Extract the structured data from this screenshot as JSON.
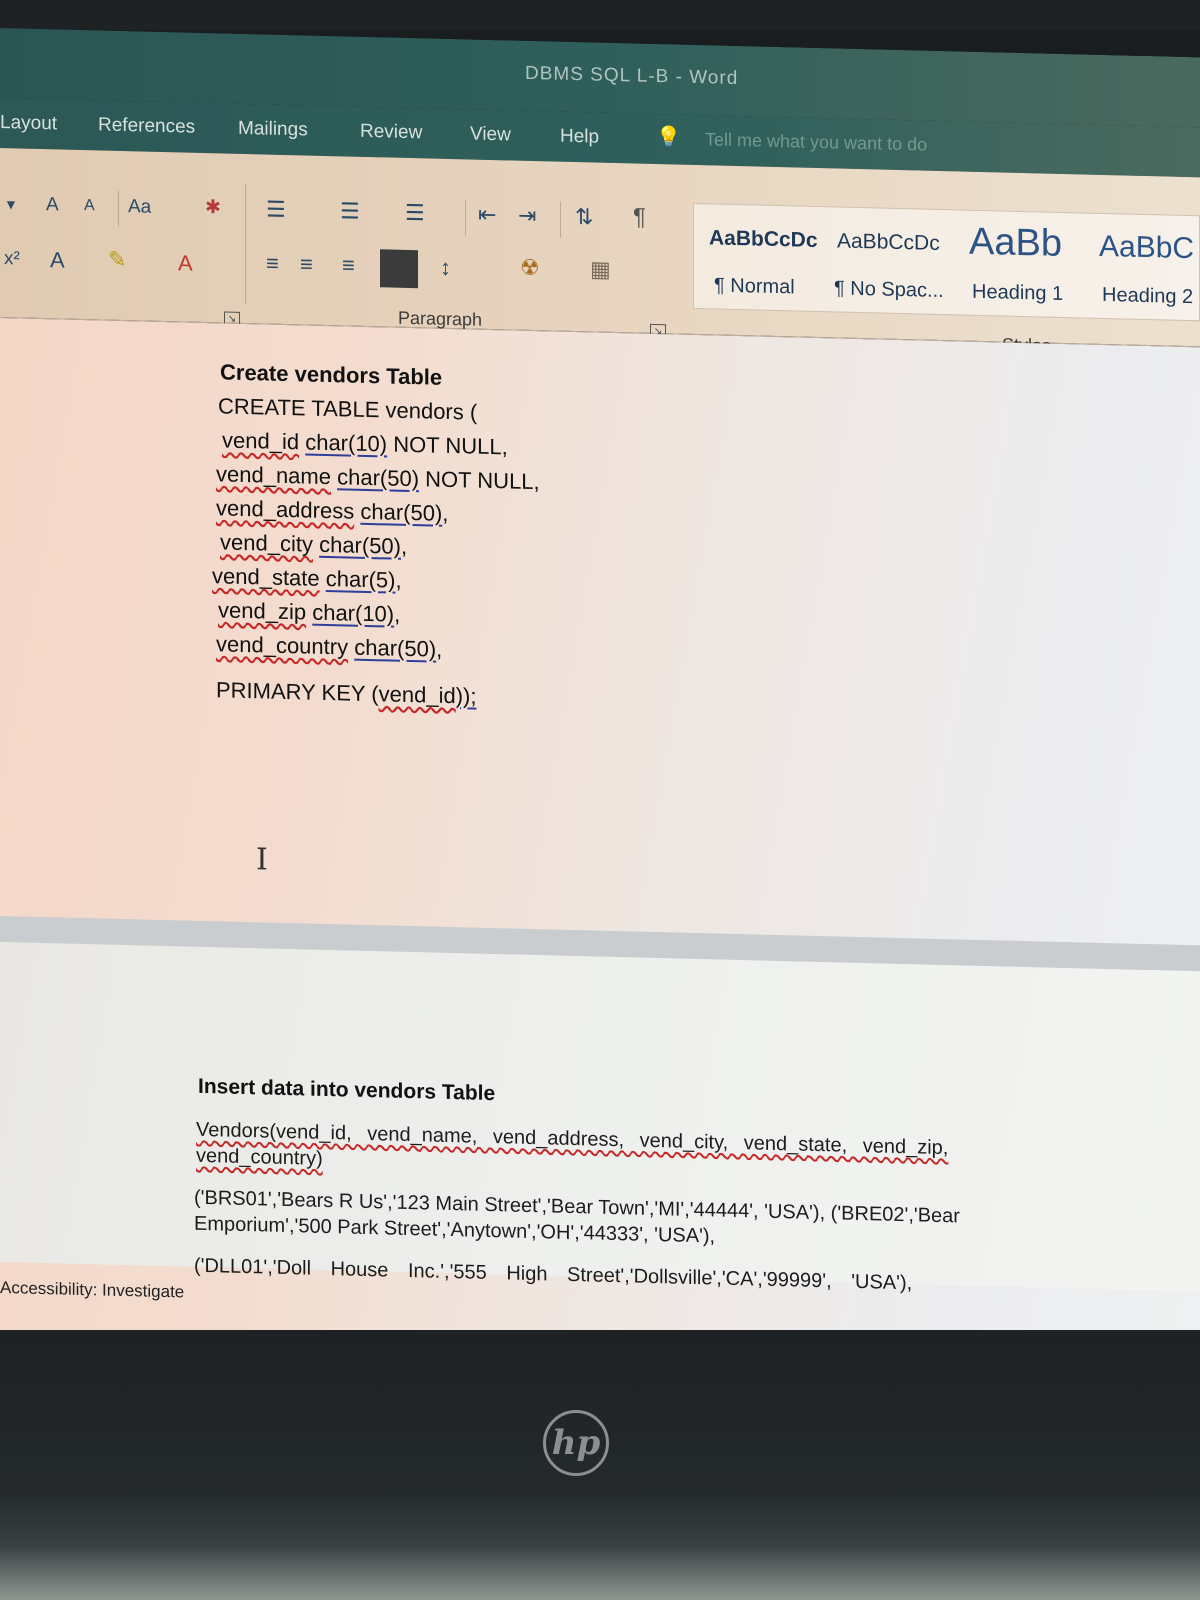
{
  "window": {
    "title": "DBMS SQL L-B - Word"
  },
  "tabs": [
    "Layout",
    "References",
    "Mailings",
    "Review",
    "View",
    "Help"
  ],
  "tell_me": {
    "placeholder": "Tell me what you want to do"
  },
  "ribbon": {
    "font_controls": [
      "A",
      "A",
      "Aa",
      "x²",
      "A",
      "A"
    ],
    "paragraph_group_label": "Paragraph",
    "styles_group_label": "Styles",
    "styles": [
      {
        "preview": "AaBbCcDc",
        "name": "¶ Normal"
      },
      {
        "preview": "AaBbCcDc",
        "name": "¶ No Spac..."
      },
      {
        "preview": "AaBb",
        "name": "Heading 1"
      },
      {
        "preview": "AaBbC",
        "name": "Heading 2"
      }
    ]
  },
  "document": {
    "section1_heading": "Create vendors Table",
    "create_stmt": "CREATE TABLE vendors (",
    "columns": [
      {
        "name": "vend_id",
        "type": "char(10)",
        "suffix": " NOT NULL,"
      },
      {
        "name": "vend_name",
        "type": "char(50)",
        "suffix": " NOT NULL,"
      },
      {
        "name": "vend_address",
        "type": "char(50)",
        "suffix": ","
      },
      {
        "name": "vend_city",
        "type": "char(50)",
        "suffix": ","
      },
      {
        "name": "vend_state",
        "type": "char(5)",
        "suffix": ","
      },
      {
        "name": "vend_zip",
        "type": "char(10)",
        "suffix": ","
      },
      {
        "name": "vend_country",
        "type": "char(50)",
        "suffix": ","
      }
    ],
    "primary_key": {
      "prefix": "PRIMARY KEY (",
      "column": "vend_id",
      "suffix": "));"
    },
    "section2_heading": "Insert data into vendors Table",
    "insert_columns_line1": "Vendors(vend_id, vend_name, vend_address, vend_city, vend_state, vend_zip,",
    "insert_columns_line2": "vend_country)",
    "insert_values_1": "('BRS01','Bears R Us','123 Main Street','Bear Town','MI','44444', 'USA'), ('BRE02','Bear Emporium','500 Park Street','Anytown','OH','44333', 'USA'),",
    "insert_values_2": "('DLL01','Doll House Inc.','555 High Street','Dollsville','CA','99999', 'USA'),"
  },
  "status_bar": {
    "accessibility": "Accessibility: Investigate"
  },
  "device": {
    "logo": "hp"
  }
}
